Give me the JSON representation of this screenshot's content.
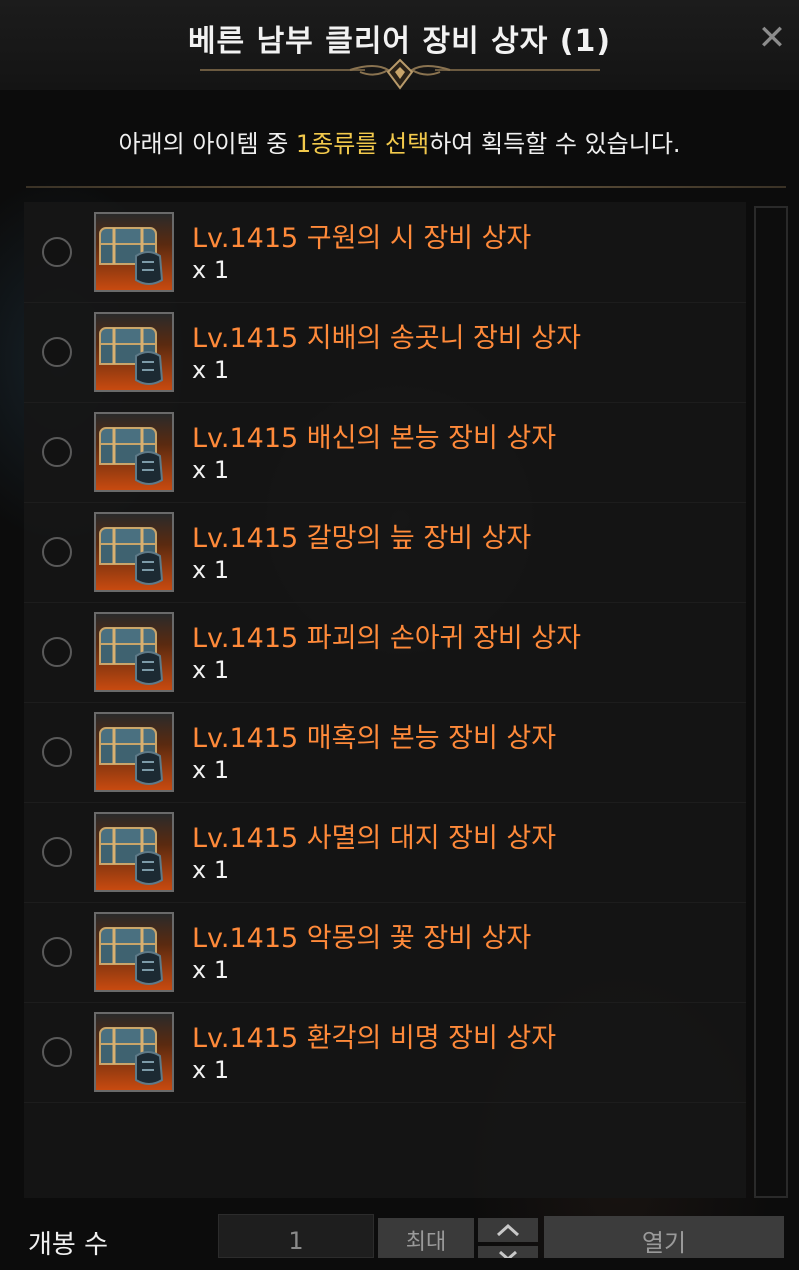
{
  "dialog": {
    "title": "베른 남부 클리어 장비 상자 (1)",
    "close_icon": "close-icon",
    "instruction_prefix": "아래의 아이템 중 ",
    "instruction_highlight": "1종류를 선택",
    "instruction_suffix": "하여 획득할 수 있습니다."
  },
  "colors": {
    "item_name": "#ff8a3a",
    "highlight": "#f2c94c",
    "background": "#0c0c0c"
  },
  "items": [
    {
      "name": "Lv.1415 구원의 시 장비 상자",
      "qty": "x 1"
    },
    {
      "name": "Lv.1415 지배의 송곳니 장비 상자",
      "qty": "x 1"
    },
    {
      "name": "Lv.1415 배신의 본능 장비 상자",
      "qty": "x 1"
    },
    {
      "name": "Lv.1415 갈망의 늪 장비 상자",
      "qty": "x 1"
    },
    {
      "name": "Lv.1415 파괴의 손아귀 장비 상자",
      "qty": "x 1"
    },
    {
      "name": "Lv.1415 매혹의 본능 장비 상자",
      "qty": "x 1"
    },
    {
      "name": "Lv.1415 사멸의 대지 장비 상자",
      "qty": "x 1"
    },
    {
      "name": "Lv.1415 악몽의 꽃 장비 상자",
      "qty": "x 1"
    },
    {
      "name": "Lv.1415 환각의 비명 장비 상자",
      "qty": "x 1"
    }
  ],
  "footer": {
    "label": "개봉 수",
    "count": "1",
    "max_label": "최대",
    "open_label": "열기"
  }
}
